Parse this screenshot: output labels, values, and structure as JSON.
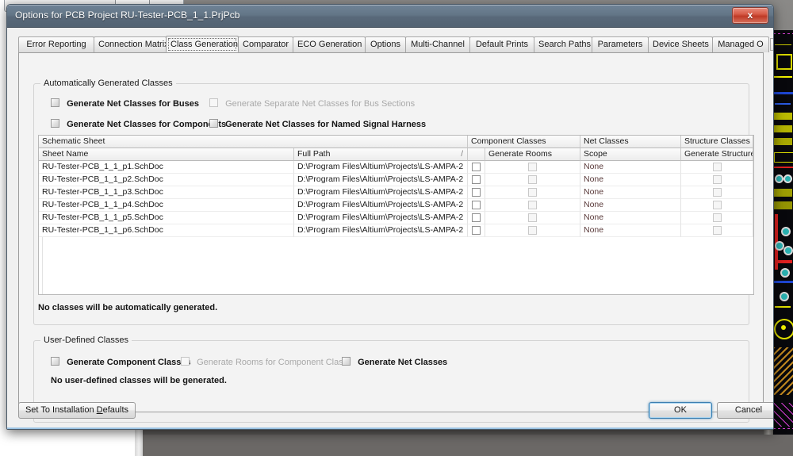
{
  "window": {
    "title": "Options for PCB Project RU-Tester-PCB_1_1.PrjPcb",
    "close_label": "x",
    "close_icon": "close-icon",
    "titlebar_color": "#5e6f80"
  },
  "tabs": {
    "items": [
      {
        "label": "Error Reporting",
        "active": false
      },
      {
        "label": "Connection Matrix",
        "active": false
      },
      {
        "label": "Class Generation",
        "active": true
      },
      {
        "label": "Comparator",
        "active": false
      },
      {
        "label": "ECO Generation",
        "active": false
      },
      {
        "label": "Options",
        "active": false
      },
      {
        "label": "Multi-Channel",
        "active": false
      },
      {
        "label": "Default Prints",
        "active": false
      },
      {
        "label": "Search Paths",
        "active": false
      },
      {
        "label": "Parameters",
        "active": false
      },
      {
        "label": "Device Sheets",
        "active": false
      },
      {
        "label": "Managed O",
        "active": false
      }
    ],
    "scroll_left": "◄",
    "scroll_right": "►"
  },
  "auto_group": {
    "title": "Automatically Generated Classes",
    "checkboxes": [
      {
        "label": "Generate Net Classes for Buses",
        "checked": false,
        "disabled": false
      },
      {
        "label": "Generate Separate Net Classes for Bus Sections",
        "checked": false,
        "disabled": true
      },
      {
        "label": "Generate Net Classes for Components",
        "checked": false,
        "disabled": false
      },
      {
        "label": "Generate Net Classes for Named Signal Harness",
        "checked": false,
        "disabled": false
      }
    ],
    "status_text": "No classes will be automatically generated."
  },
  "grid": {
    "group_headers": [
      {
        "label": "Schematic Sheet"
      },
      {
        "label": "Component Classes"
      },
      {
        "label": "Net Classes"
      },
      {
        "label": "Structure Classes"
      }
    ],
    "columns": [
      {
        "label": "Sheet Name"
      },
      {
        "label": "Full Path",
        "sorted": true,
        "sortmark": "/"
      },
      {
        "label": ""
      },
      {
        "label": "Generate Rooms"
      },
      {
        "label": "Scope"
      },
      {
        "label": "Generate Structure"
      }
    ],
    "rows": [
      {
        "sheet_name": "RU-Tester-PCB_1_1_p1.SchDoc",
        "full_path": "D:\\Program Files\\Altium\\Projects\\LS-AMPA-2",
        "component_class": false,
        "generate_rooms": false,
        "scope": "None",
        "generate_structure": false
      },
      {
        "sheet_name": "RU-Tester-PCB_1_1_p2.SchDoc",
        "full_path": "D:\\Program Files\\Altium\\Projects\\LS-AMPA-2",
        "component_class": false,
        "generate_rooms": false,
        "scope": "None",
        "generate_structure": false
      },
      {
        "sheet_name": "RU-Tester-PCB_1_1_p3.SchDoc",
        "full_path": "D:\\Program Files\\Altium\\Projects\\LS-AMPA-2",
        "component_class": false,
        "generate_rooms": false,
        "scope": "None",
        "generate_structure": false
      },
      {
        "sheet_name": "RU-Tester-PCB_1_1_p4.SchDoc",
        "full_path": "D:\\Program Files\\Altium\\Projects\\LS-AMPA-2",
        "component_class": false,
        "generate_rooms": false,
        "scope": "None",
        "generate_structure": false
      },
      {
        "sheet_name": "RU-Tester-PCB_1_1_p5.SchDoc",
        "full_path": "D:\\Program Files\\Altium\\Projects\\LS-AMPA-2",
        "component_class": false,
        "generate_rooms": false,
        "scope": "None",
        "generate_structure": false
      },
      {
        "sheet_name": "RU-Tester-PCB_1_1_p6.SchDoc",
        "full_path": "D:\\Program Files\\Altium\\Projects\\LS-AMPA-2",
        "component_class": false,
        "generate_rooms": false,
        "scope": "None",
        "generate_structure": false
      }
    ]
  },
  "user_group": {
    "title": "User-Defined Classes",
    "checkboxes": [
      {
        "label": "Generate Component Classes",
        "checked": false,
        "disabled": false
      },
      {
        "label": "Generate Rooms for Component Class",
        "checked": false,
        "disabled": true
      },
      {
        "label": "Generate Net Classes",
        "checked": false,
        "disabled": false
      }
    ],
    "status_text": "No user-defined classes will be generated."
  },
  "footer": {
    "defaults_label_pre": "Set To Installation ",
    "defaults_accel": "D",
    "defaults_label_post": "efaults",
    "ok_label": "OK",
    "cancel_label": "Cancel"
  }
}
